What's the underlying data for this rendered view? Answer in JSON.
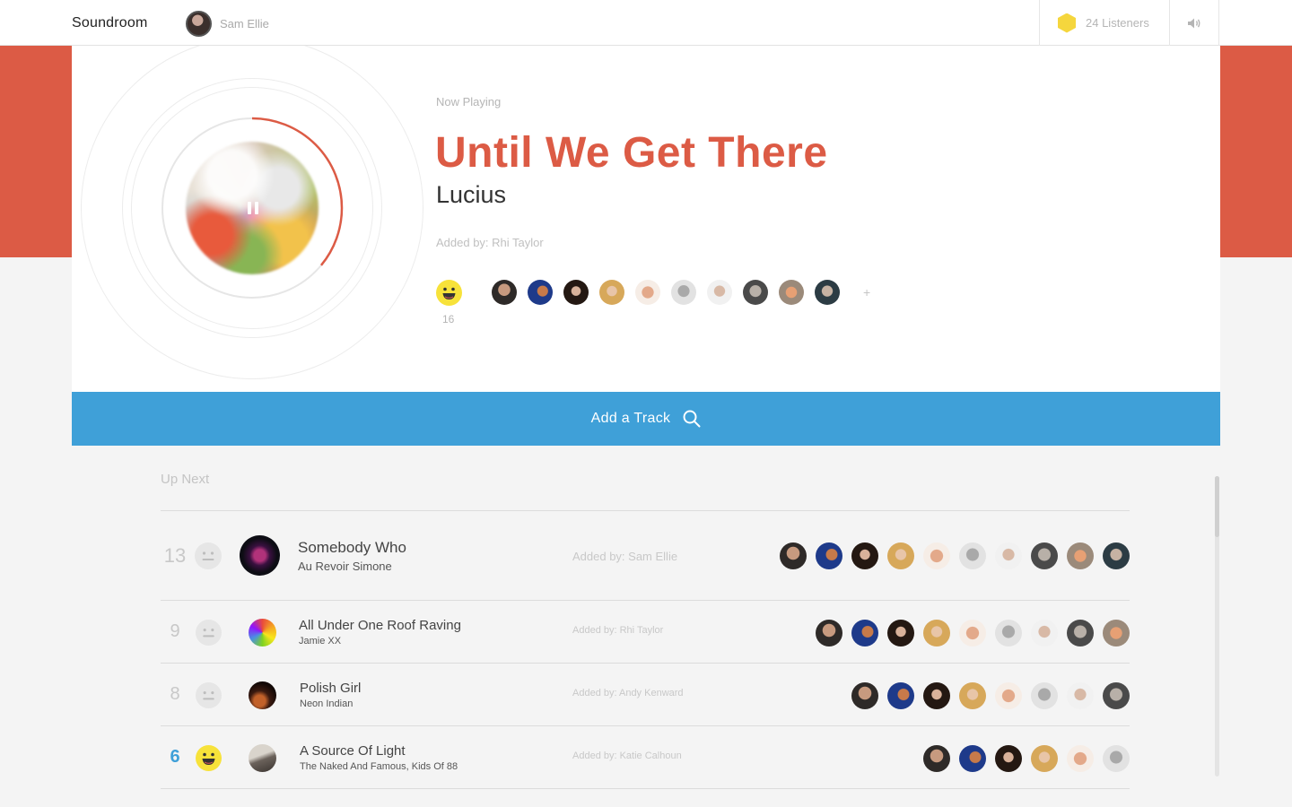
{
  "header": {
    "brand": "Soundroom",
    "user_name": "Sam Ellie",
    "listeners": "24 Listeners",
    "volume_icon": "volume-icon",
    "hex_color": "#f5d63d"
  },
  "now_playing": {
    "label": "Now Playing",
    "title": "Until We Get There",
    "artist": "Lucius",
    "added_by": "Added by: Rhi Taylor",
    "vote_count": "16",
    "progress": 0.36,
    "plus": "+",
    "accent": "#dc5b45"
  },
  "add_track": {
    "label": "Add a Track",
    "color": "#3fa0d8"
  },
  "up_next": {
    "label": "Up Next",
    "tracks": [
      {
        "score": "13",
        "title": "Somebody Who",
        "artist": "Au Revoir Simone",
        "added_by": "Added by: Sam Ellie",
        "voted": false,
        "voter_count": 10
      },
      {
        "score": "9",
        "title": "All Under One Roof Raving",
        "artist": "Jamie XX",
        "added_by": "Added by: Rhi Taylor",
        "voted": false,
        "voter_count": 9
      },
      {
        "score": "8",
        "title": "Polish Girl",
        "artist": "Neon Indian",
        "added_by": "Added by: Andy Kenward",
        "voted": false,
        "voter_count": 8
      },
      {
        "score": "6",
        "title": "A Source Of Light",
        "artist": "The Naked And Famous, Kids Of 88",
        "added_by": "Added by: Katie Calhoun",
        "voted": true,
        "voter_count": 6
      }
    ]
  }
}
